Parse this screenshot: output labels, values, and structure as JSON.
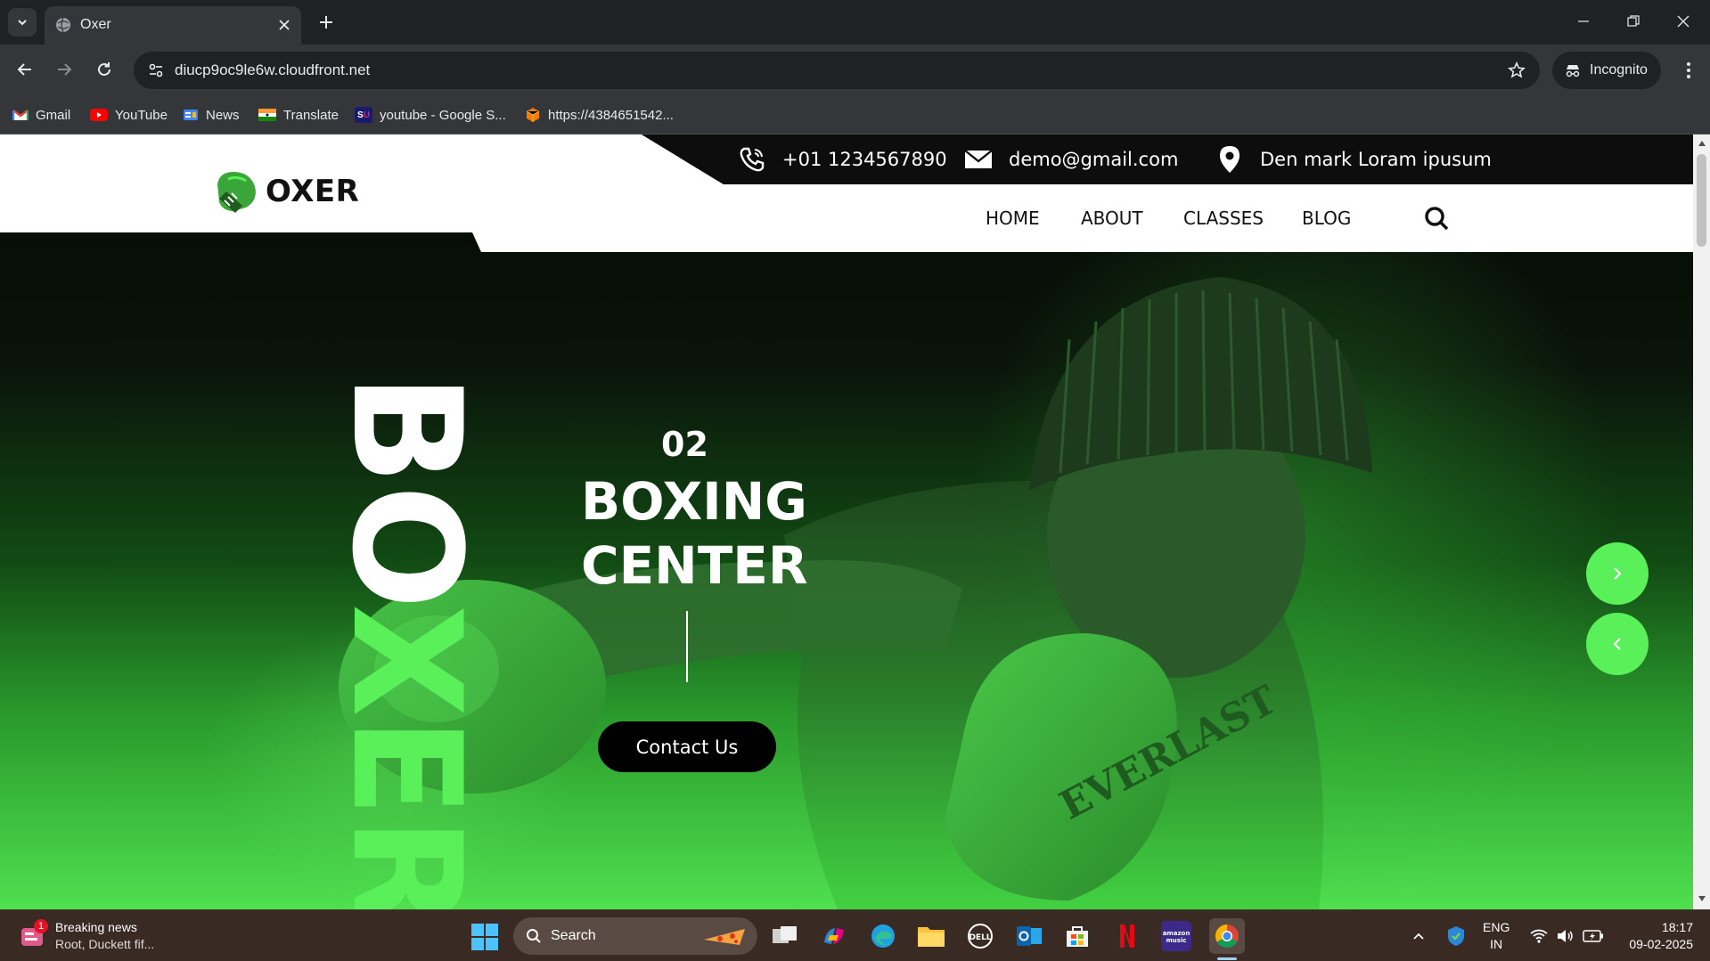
{
  "browser": {
    "tab_title": "Oxer",
    "url": "diucp9oc9le6w.cloudfront.net",
    "incognito_label": "Incognito",
    "bookmarks": [
      {
        "label": "Gmail",
        "icon": "gmail-icon",
        "color": "#ea4335"
      },
      {
        "label": "YouTube",
        "icon": "youtube-icon",
        "color": "#ff0000"
      },
      {
        "label": "News",
        "icon": "google-news-icon",
        "color": "#4285f4"
      },
      {
        "label": "Translate",
        "icon": "india-flag-icon",
        "color": "#ff9933"
      },
      {
        "label": "youtube - Google S...",
        "icon": "su-icon",
        "color": "#c2185b"
      },
      {
        "label": "https://4384651542...",
        "icon": "cube-icon",
        "color": "#f57c00"
      }
    ]
  },
  "site": {
    "brand": "OXER",
    "brand_color": "#5af05a",
    "phone": "+01 1234567890",
    "email": "demo@gmail.com",
    "address": "Den mark Loram ipusum",
    "nav": [
      "HOME",
      "ABOUT",
      "CLASSES",
      "BLOG"
    ],
    "hero": {
      "vertical_word": "BOXER",
      "slide_number": "02",
      "title_line1": "BOXING",
      "title_line2": "CENTER",
      "cta": "Contact Us",
      "glove_text": "EVERLAST"
    }
  },
  "taskbar": {
    "news_title": "Breaking news",
    "news_sub": "Root, Duckett fif...",
    "news_badge": "1",
    "search_label": "Search",
    "lang_line1": "ENG",
    "lang_line2": "IN",
    "time": "18:17",
    "date": "09-02-2025"
  }
}
